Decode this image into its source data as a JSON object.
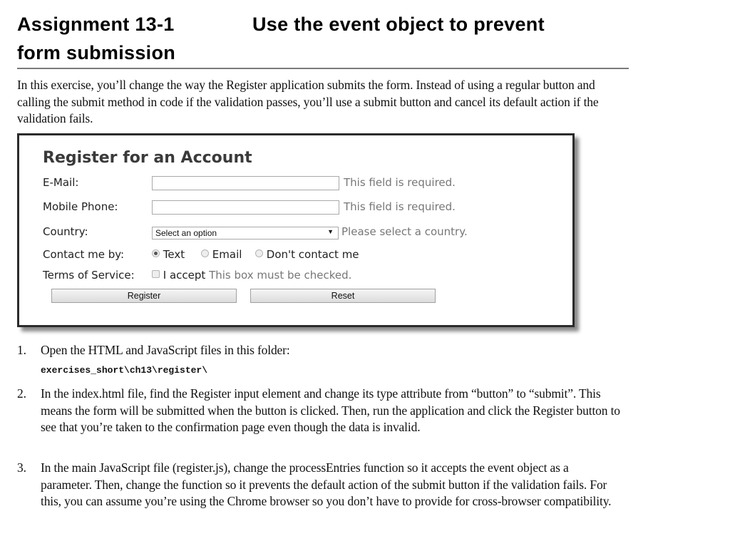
{
  "heading": {
    "number": "Assignment 13-1",
    "title_line1": "Use the event object to prevent",
    "title_line2": "form submission"
  },
  "intro": "In this exercise, you’ll change the way the Register application submits the form. Instead of using a regular button and calling the submit method in code if the validation passes, you’ll use a submit button and cancel its default action if the validation fails.",
  "form": {
    "title": "Register for an Account",
    "email": {
      "label": "E-Mail:",
      "value": "",
      "message": "This field is required."
    },
    "phone": {
      "label": "Mobile Phone:",
      "value": "",
      "message": "This field is required."
    },
    "country": {
      "label": "Country:",
      "selected": "Select an option",
      "arrow_icon": "▼",
      "message": "Please select a country."
    },
    "contact": {
      "label": "Contact me by:",
      "options": [
        {
          "label": "Text",
          "checked": true
        },
        {
          "label": "Email",
          "checked": false
        },
        {
          "label": "Don't contact me",
          "checked": false
        }
      ]
    },
    "terms": {
      "label": "Terms of Service:",
      "checkbox_label": "I accept",
      "checked": false,
      "message": "This box must be checked."
    },
    "register_button": "Register",
    "reset_button": "Reset"
  },
  "steps": [
    {
      "number": "1.",
      "text": "Open the HTML and JavaScript files in this folder:",
      "code": "exercises_short\\ch13\\register\\"
    },
    {
      "number": "2.",
      "text": "In the index.html file, find the Register input element and change its type attribute from “button” to “submit”. This means the form will be submitted when the button is clicked. Then, run the application and click the Register button to see that you’re taken to the confirmation page even though the data is invalid."
    },
    {
      "number": "3.",
      "text": "In the main JavaScript file (register.js), change the processEntries function so it accepts the event object as a parameter. Then, change the function so it prevents the default action of the submit button if the validation fails. For this, you can assume you’re using the Chrome browser so you don’t have to provide for cross-browser compatibility."
    }
  ]
}
